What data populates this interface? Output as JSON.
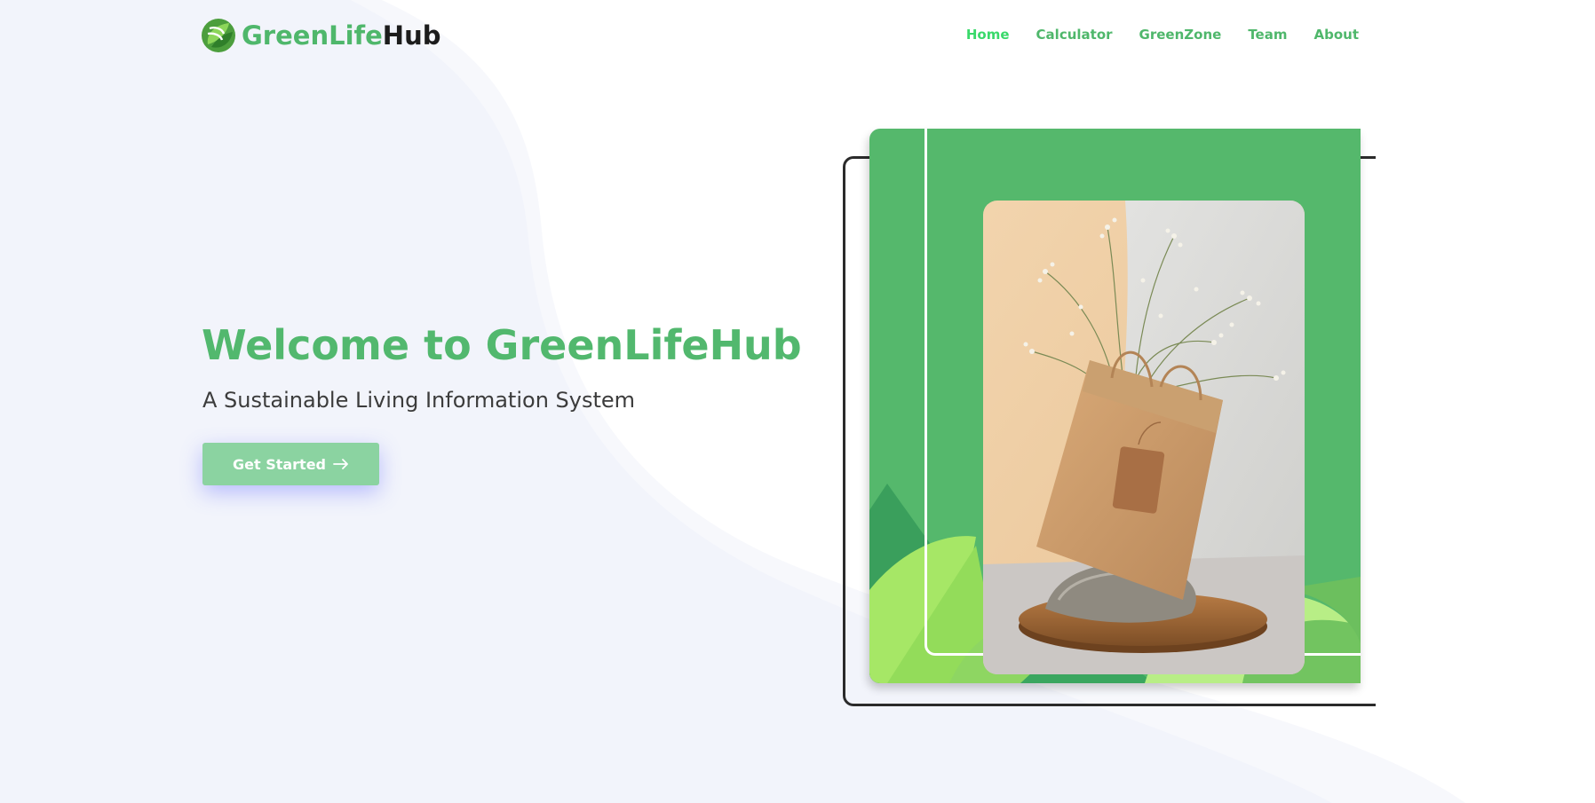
{
  "brand": {
    "name_part1": "GreenLife",
    "name_part2": "Hub",
    "logo_icon": "leaf-swirl-icon",
    "primary_color": "#4fb76b",
    "dark_color": "#1c1c1c"
  },
  "nav": {
    "items": [
      {
        "label": "Home",
        "active": true
      },
      {
        "label": "Calculator",
        "active": false
      },
      {
        "label": "GreenZone",
        "active": false
      },
      {
        "label": "Team",
        "active": false
      },
      {
        "label": "About",
        "active": false
      }
    ],
    "active_color": "#39d96a"
  },
  "hero": {
    "title": "Welcome to GreenLifeHub",
    "subtitle": "A Sustainable Living Information System",
    "cta_label": "Get Started",
    "cta_icon": "arrow-right-icon",
    "cta_color": "#8bd3a1"
  },
  "illustration": {
    "card_color": "#55b86c",
    "photo_subject": "paper-bag-with-flowers-image"
  }
}
